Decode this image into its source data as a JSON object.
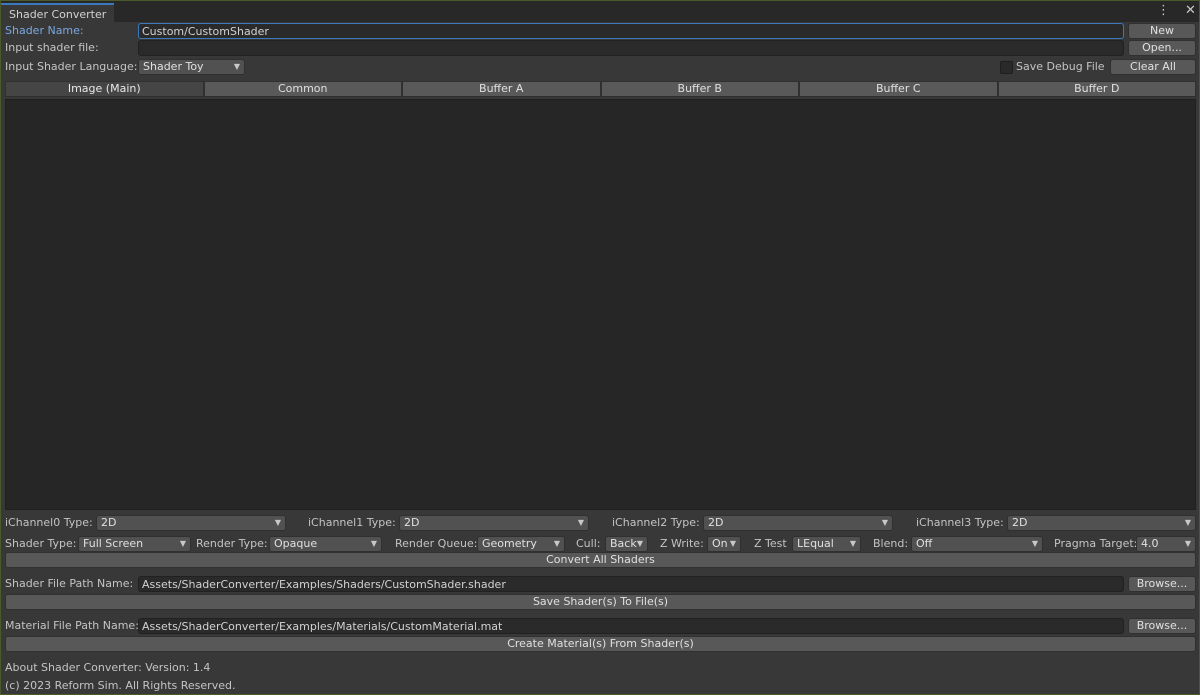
{
  "window": {
    "tab_title": "Shader Converter",
    "menu_icon": "kebab-menu-icon",
    "close_icon": "close-icon",
    "menu_glyph": "⋮",
    "close_glyph": "✕"
  },
  "shader_name": {
    "label": "Shader Name:",
    "value": "Custom/CustomShader",
    "new_button": "New"
  },
  "input_file": {
    "label": "Input shader file:",
    "value": "",
    "open_button": "Open..."
  },
  "input_language": {
    "label": "Input Shader Language:",
    "selected": "Shader Toy",
    "save_debug_label": "Save Debug File",
    "clear_all_button": "Clear All"
  },
  "tabs": [
    "Image (Main)",
    "Common",
    "Buffer A",
    "Buffer B",
    "Buffer C",
    "Buffer D"
  ],
  "channels": [
    {
      "label": "iChannel0 Type:",
      "value": "2D"
    },
    {
      "label": "iChannel1 Type:",
      "value": "2D"
    },
    {
      "label": "iChannel2 Type:",
      "value": "2D"
    },
    {
      "label": "iChannel3 Type:",
      "value": "2D"
    }
  ],
  "settings": {
    "shader_type_label": "Shader Type:",
    "shader_type": "Full Screen",
    "render_type_label": "Render Type:",
    "render_type": "Opaque",
    "render_queue_label": "Render Queue:",
    "render_queue": "Geometry",
    "cull_label": "Cull:",
    "cull": "Back",
    "zwrite_label": "Z Write:",
    "zwrite": "On",
    "ztest_label": "Z Test",
    "ztest": "LEqual",
    "blend_label": "Blend:",
    "blend": "Off",
    "pragma_label": "Pragma Target:",
    "pragma": "4.0"
  },
  "convert_button": "Convert All Shaders",
  "shader_path": {
    "label": "Shader File Path Name:",
    "value": "Assets/ShaderConverter/Examples/Shaders/CustomShader.shader",
    "browse_button": "Browse...",
    "save_button": "Save Shader(s) To File(s)"
  },
  "material_path": {
    "label": "Material File Path Name:",
    "value": "Assets/ShaderConverter/Examples/Materials/CustomMaterial.mat",
    "browse_button": "Browse...",
    "create_button": "Create Material(s) From Shader(s)"
  },
  "footer": {
    "about": "About Shader Converter: Version: 1.4",
    "copyright": "(c) 2023 Reform Sim. All Rights Reserved."
  }
}
